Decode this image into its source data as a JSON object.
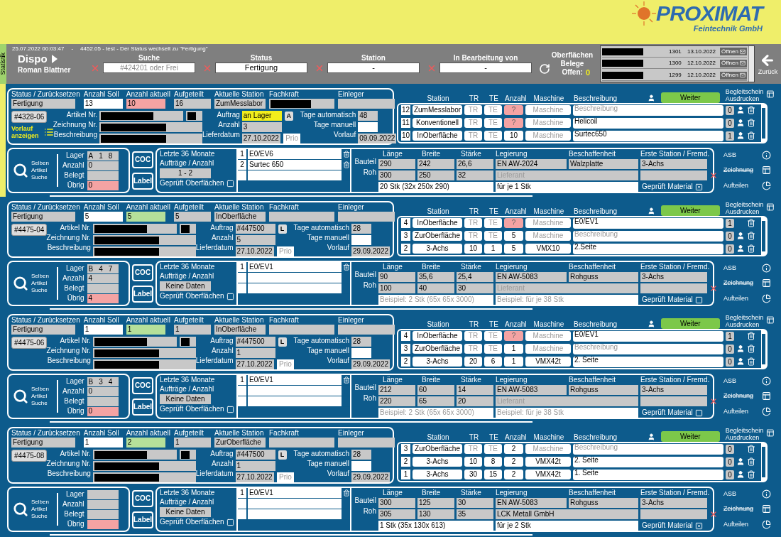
{
  "header": {
    "logo": {
      "name": "PROXIMAT",
      "tagline": "Feintechnik GmbH"
    }
  },
  "toolbar": {
    "side_tab": "Statistik",
    "timestamp": "25.07.2022 00:03:47",
    "separator": "-",
    "message": "4452.05 - test - Der Status wechselt zu \"Fertigung\"",
    "title": "Dispo",
    "user": "Roman Blattner",
    "filters": [
      {
        "label": "Suche",
        "placeholder": "#424201 oder Frei"
      },
      {
        "label": "Status",
        "value": "Fertigung"
      },
      {
        "label": "Station",
        "value": "-"
      },
      {
        "label": "In Bearbeitung von",
        "value": "-"
      }
    ],
    "open_title": "Oberflächen Belege",
    "open_label": "Offen:",
    "open_count": "0",
    "documents": [
      {
        "redacted": true,
        "number": "1301",
        "date": "13.10.2022",
        "action": "Öffnen"
      },
      {
        "redacted": true,
        "number": "1300",
        "date": "12.10.2022",
        "action": "Öffnen"
      },
      {
        "redacted": true,
        "number": "1299",
        "date": "12.10.2022",
        "action": "Öffnen"
      }
    ],
    "back": "Zurück"
  },
  "records": [
    {
      "selected": true,
      "id": "#4328-06",
      "vorlauf_link": "Vorlauf anzeigen",
      "labels": {
        "status": "Status / Zurücksetzen",
        "soll": "Anzahl Soll",
        "aktuell": "Anzahl aktuell",
        "aufgeteilt": "Aufgeteilt",
        "station": "Aktuelle Station",
        "fachkraft": "Fachkraft",
        "einleger": "Einleger",
        "artikel": "Artikel Nr.",
        "zeichnung": "Zeichnung Nr.",
        "beschreibung": "Beschreibung",
        "auftrag": "Auftrag",
        "anzahl": "Anzahl",
        "lieferdatum": "Lieferdatum",
        "prio": "Prio",
        "tage_auto": "Tage automatisch",
        "tage_manuell": "Tage manuell",
        "vorlauf": "Vorlauf",
        "search": "Selben Artikel Suche",
        "lager": "Lager",
        "lager_anzahl": "Anzahl",
        "belegt": "Belegt",
        "uebrig": "Übrig",
        "coc": "COC",
        "label": "Label",
        "letzte": "Letzte 36 Monate",
        "auftraege": "Aufträge / Anzahl",
        "geprueft_of": "Geprüft Oberflächen",
        "bauteil": "Bauteil",
        "roh": "Roh",
        "dims": [
          "Länge",
          "Breite",
          "Stärke",
          "Legierung",
          "Beschaffenheit",
          "Erste Station / Fremd."
        ],
        "geprueft_mat": "Geprüft Material",
        "step_cols": [
          "Station",
          "TR",
          "TE",
          "Anzahl",
          "Maschine",
          "Beschreibung"
        ],
        "weiter": "Weiter",
        "begleitschein": "Begleitschein Ausdrucken",
        "asb": "ASB",
        "zeichnung_link": "Zeichnung",
        "aufteilen": "Aufteilen"
      },
      "status": "Fertigung",
      "soll": "13",
      "aktuell": {
        "value": "10",
        "matches": false
      },
      "aufgeteilt": "16",
      "station": "ZumMesslabor",
      "fachkraft": {
        "redacted": true
      },
      "artikel": {
        "redacted": true
      },
      "artikel_code": {
        "redacted": true
      },
      "zeichnung": {
        "redacted": true
      },
      "beschreibung": {
        "redacted": true
      },
      "auftrag": {
        "value": "an Lager",
        "highlighted": true
      },
      "auftrag_button": "A",
      "anzahl": "3",
      "lieferdatum": "27.10.2022",
      "tage_auto": "48",
      "vorlauf": "09.09.2022",
      "lager": [
        "A",
        "1",
        "8"
      ],
      "lager_anzahl": "0",
      "uebrig": "0",
      "stats": "1 - 2",
      "geprueft_of": false,
      "surfaces": [
        {
          "no": "1",
          "name": "E0/EV6"
        },
        {
          "no": "2",
          "name": "Surtec 650"
        }
      ],
      "bauteil": [
        "290",
        "242",
        "26,6"
      ],
      "roh": [
        "300",
        "250",
        "32"
      ],
      "legierung": "EN AW-2024",
      "beschaffenheit": "Walzplatte",
      "erste_station": "3-Achs",
      "lieferant": {
        "placeholder": "Lieferant"
      },
      "stueck": {
        "value": "20 Stk (32x 250x 290)"
      },
      "je": {
        "value": "für je 1 Stk"
      },
      "geprueft_mat": true,
      "steps": [
        {
          "no": "12",
          "station": "ZumMesslabor",
          "tr": {
            "placeholder": "TR"
          },
          "te": {
            "placeholder": "TE"
          },
          "anzahl": {
            "placeholder": "?",
            "warn": true
          },
          "maschine": {
            "placeholder": "Maschine"
          },
          "beschreibung": {
            "placeholder": "Beschreibung"
          },
          "count": "0",
          "person": true
        },
        {
          "no": "11",
          "station": "Konventionell",
          "tr": {
            "placeholder": "TR"
          },
          "te": {
            "placeholder": "TE"
          },
          "anzahl": {
            "placeholder": "?",
            "warn": true
          },
          "maschine": {
            "placeholder": "Maschine"
          },
          "beschreibung": {
            "value": "Helicoil"
          },
          "count": "0",
          "person": true
        },
        {
          "no": "10",
          "station": "InOberfläche",
          "tr": {
            "placeholder": "TR"
          },
          "te": {
            "placeholder": "TE"
          },
          "anzahl": {
            "value": "10",
            "warn": false
          },
          "maschine": {
            "placeholder": "Maschine"
          },
          "beschreibung": {
            "value": "Surtec650"
          },
          "count": "1",
          "person": true
        }
      ]
    },
    {
      "selected": false,
      "id": "#4475-04",
      "labels": {
        "status": "Status / Zurücksetzen",
        "soll": "Anzahl Soll",
        "aktuell": "Anzahl aktuell",
        "aufgeteilt": "Aufgeteilt",
        "station": "Aktuelle Station",
        "fachkraft": "Fachkraft",
        "einleger": "Einleger",
        "artikel": "Artikel Nr.",
        "zeichnung": "Zeichnung Nr.",
        "beschreibung": "Beschreibung",
        "auftrag": "Auftrag",
        "anzahl": "Anzahl",
        "lieferdatum": "Lieferdatum",
        "prio": "Prio",
        "tage_auto": "Tage automatisch",
        "tage_manuell": "Tage manuell",
        "vorlauf": "Vorlauf",
        "search": "Selben Artikel Suche",
        "lager": "Lager",
        "lager_anzahl": "Anzahl",
        "belegt": "Belegt",
        "uebrig": "Übrig",
        "coc": "COC",
        "label": "Label",
        "letzte": "Letzte 36 Monate",
        "auftraege": "Aufträge / Anzahl",
        "geprueft_of": "Geprüft Oberflächen",
        "bauteil": "Bauteil",
        "roh": "Roh",
        "dims": [
          "Länge",
          "Breite",
          "Stärke",
          "Legierung",
          "Beschaffenheit",
          "Erste Station / Fremd."
        ],
        "geprueft_mat": "Geprüft Material",
        "step_cols": [
          "Station",
          "TR",
          "TE",
          "Anzahl",
          "Maschine",
          "Beschreibung"
        ],
        "weiter": "Weiter",
        "begleitschein": "Begleitschein Ausdrucken",
        "asb": "ASB",
        "zeichnung_link": "Zeichnung",
        "aufteilen": "Aufteilen"
      },
      "status": "Fertigung",
      "soll": "5",
      "aktuell": {
        "value": "5",
        "matches": true
      },
      "aufgeteilt": "5",
      "station": "InOberfläche",
      "artikel": {
        "redacted": true
      },
      "artikel_code": {
        "redacted": true
      },
      "zeichnung": {
        "redacted": true
      },
      "beschreibung": {
        "redacted": true
      },
      "auftrag": {
        "value": "#447500",
        "highlighted": false
      },
      "auftrag_button": "L",
      "anzahl": "5",
      "lieferdatum": "27.10.2022",
      "tage_auto": "28",
      "vorlauf": "29.09.2022",
      "lager": [
        "B",
        "4",
        "7"
      ],
      "lager_anzahl": "4",
      "uebrig": "4",
      "stats": "Keine Daten",
      "geprueft_of": false,
      "surfaces": [
        {
          "no": "1",
          "name": "E0/EV1"
        }
      ],
      "bauteil": [
        "90",
        "35,6",
        "25,4"
      ],
      "roh": [
        "100",
        "40",
        "30"
      ],
      "legierung": "EN AW-5083",
      "beschaffenheit": "Rohguss",
      "erste_station": "3-Achs",
      "lieferant": {
        "placeholder": "Lieferant"
      },
      "stueck": {
        "placeholder": "Beispiel: 2 Stk (65x 65x 3000)"
      },
      "je": {
        "placeholder": "Beispiel: für je 38 Stk"
      },
      "geprueft_mat": false,
      "steps": [
        {
          "no": "4",
          "station": "InOberfläche",
          "tr": {
            "placeholder": "TR"
          },
          "te": {
            "placeholder": "TE"
          },
          "anzahl": {
            "placeholder": "?",
            "warn": true
          },
          "maschine": {
            "placeholder": "Maschine"
          },
          "beschreibung": {
            "value": "E0/EV1"
          },
          "count": "1",
          "person": false
        },
        {
          "no": "3",
          "station": "ZurOberfläche",
          "tr": {
            "placeholder": "TR"
          },
          "te": {
            "placeholder": "TE"
          },
          "anzahl": {
            "value": "5",
            "warn": false
          },
          "maschine": {
            "placeholder": "Maschine"
          },
          "beschreibung": {
            "placeholder": "Beschreibung"
          },
          "count": "0",
          "person": true
        },
        {
          "no": "2",
          "station": "3-Achs",
          "tr": {
            "value": "10"
          },
          "te": {
            "value": "1"
          },
          "anzahl": {
            "value": "5",
            "warn": false
          },
          "maschine": {
            "value": "VMX10"
          },
          "beschreibung": {
            "value": "2.Seite"
          },
          "count": "0",
          "person": true
        }
      ]
    },
    {
      "selected": false,
      "id": "#4475-06",
      "labels": {
        "status": "Status / Zurücksetzen",
        "soll": "Anzahl Soll",
        "aktuell": "Anzahl aktuell",
        "aufgeteilt": "Aufgeteilt",
        "station": "Aktuelle Station",
        "fachkraft": "Fachkraft",
        "einleger": "Einleger",
        "artikel": "Artikel Nr.",
        "zeichnung": "Zeichnung Nr.",
        "beschreibung": "Beschreibung",
        "auftrag": "Auftrag",
        "anzahl": "Anzahl",
        "lieferdatum": "Lieferdatum",
        "prio": "Prio",
        "tage_auto": "Tage automatisch",
        "tage_manuell": "Tage manuell",
        "vorlauf": "Vorlauf",
        "search": "Selben Artikel Suche",
        "lager": "Lager",
        "lager_anzahl": "Anzahl",
        "belegt": "Belegt",
        "uebrig": "Übrig",
        "coc": "COC",
        "label": "Label",
        "letzte": "Letzte 36 Monate",
        "auftraege": "Aufträge / Anzahl",
        "geprueft_of": "Geprüft Oberflächen",
        "bauteil": "Bauteil",
        "roh": "Roh",
        "dims": [
          "Länge",
          "Breite",
          "Stärke",
          "Legierung",
          "Beschaffenheit",
          "Erste Station / Fremd."
        ],
        "geprueft_mat": "Geprüft Material",
        "step_cols": [
          "Station",
          "TR",
          "TE",
          "Anzahl",
          "Maschine",
          "Beschreibung"
        ],
        "weiter": "Weiter",
        "begleitschein": "Begleitschein Ausdrucken",
        "asb": "ASB",
        "zeichnung_link": "Zeichnung",
        "aufteilen": "Aufteilen"
      },
      "status": "Fertigung",
      "soll": "1",
      "aktuell": {
        "value": "1",
        "matches": true
      },
      "aufgeteilt": "1",
      "station": "InOberfläche",
      "artikel": {
        "redacted": true
      },
      "artikel_code": {
        "redacted": true
      },
      "zeichnung": {
        "redacted": true
      },
      "beschreibung": {
        "redacted": true
      },
      "auftrag": {
        "value": "#447500",
        "highlighted": false
      },
      "auftrag_button": "L",
      "anzahl": "1",
      "lieferdatum": "27.10.2022",
      "tage_auto": "28",
      "vorlauf": "29.09.2022",
      "lager": [
        "B",
        "3",
        "4"
      ],
      "lager_anzahl": "0",
      "uebrig": "0",
      "stats": "Keine Daten",
      "geprueft_of": false,
      "surfaces": [
        {
          "no": "1",
          "name": "E0/EV1"
        }
      ],
      "bauteil": [
        "212",
        "60",
        "14"
      ],
      "roh": [
        "220",
        "65",
        "20"
      ],
      "legierung": "EN AW-5083",
      "beschaffenheit": "Rohguss",
      "erste_station": "3-Achs",
      "lieferant": {
        "placeholder": "Lieferant"
      },
      "stueck": {
        "placeholder": "Beispiel: 2 Stk (65x 65x 3000)"
      },
      "je": {
        "placeholder": "Beispiel: für je 38 Stk"
      },
      "geprueft_mat": false,
      "steps": [
        {
          "no": "4",
          "station": "InOberfläche",
          "tr": {
            "placeholder": "TR"
          },
          "te": {
            "placeholder": "TE"
          },
          "anzahl": {
            "placeholder": "?",
            "warn": true
          },
          "maschine": {
            "placeholder": "Maschine"
          },
          "beschreibung": {
            "value": "E0/EV1"
          },
          "count": "1",
          "person": false
        },
        {
          "no": "3",
          "station": "ZurOberfläche",
          "tr": {
            "placeholder": "TR"
          },
          "te": {
            "placeholder": "TE"
          },
          "anzahl": {
            "value": "1",
            "warn": false
          },
          "maschine": {
            "placeholder": "Maschine"
          },
          "beschreibung": {
            "placeholder": "Beschreibung"
          },
          "count": "0",
          "person": true
        },
        {
          "no": "2",
          "station": "3-Achs",
          "tr": {
            "value": "20"
          },
          "te": {
            "value": "6"
          },
          "anzahl": {
            "value": "1",
            "warn": false
          },
          "maschine": {
            "value": "VMX42t"
          },
          "beschreibung": {
            "value": "2. Seite"
          },
          "count": "0",
          "person": true
        }
      ]
    },
    {
      "selected": false,
      "id": "#4475-08",
      "labels": {
        "status": "Status / Zurücksetzen",
        "soll": "Anzahl Soll",
        "aktuell": "Anzahl aktuell",
        "aufgeteilt": "Aufgeteilt",
        "station": "Aktuelle Station",
        "fachkraft": "Fachkraft",
        "einleger": "Einleger",
        "artikel": "Artikel Nr.",
        "zeichnung": "Zeichnung Nr.",
        "beschreibung": "Beschreibung",
        "auftrag": "Auftrag",
        "anzahl": "Anzahl",
        "lieferdatum": "Lieferdatum",
        "prio": "Prio",
        "tage_auto": "Tage automatisch",
        "tage_manuell": "Tage manuell",
        "vorlauf": "Vorlauf",
        "search": "Selben Artikel Suche",
        "lager": "Lager",
        "lager_anzahl": "Anzahl",
        "belegt": "Belegt",
        "uebrig": "Übrig",
        "coc": "COC",
        "label": "Label",
        "letzte": "Letzte 36 Monate",
        "auftraege": "Aufträge / Anzahl",
        "geprueft_of": "Geprüft Oberflächen",
        "bauteil": "Bauteil",
        "roh": "Roh",
        "dims": [
          "Länge",
          "Breite",
          "Stärke",
          "Legierung",
          "Beschaffenheit",
          "Erste Station / Fremd."
        ],
        "geprueft_mat": "Geprüft Material",
        "step_cols": [
          "Station",
          "TR",
          "TE",
          "Anzahl",
          "Maschine",
          "Beschreibung"
        ],
        "weiter": "Weiter",
        "begleitschein": "Begleitschein Ausdrucken",
        "asb": "ASB",
        "zeichnung_link": "Zeichnung",
        "aufteilen": "Aufteilen"
      },
      "status": "Fertigung",
      "soll": "1",
      "aktuell": {
        "value": "2",
        "matches": true
      },
      "aufgeteilt": "1",
      "station": "ZurOberfläche",
      "artikel": {
        "redacted": true
      },
      "artikel_code": {
        "redacted": true
      },
      "zeichnung": {
        "redacted": true
      },
      "beschreibung": {
        "redacted": true
      },
      "auftrag": {
        "value": "#447500",
        "highlighted": false
      },
      "auftrag_button": "L",
      "anzahl": "1",
      "lieferdatum": "27.10.2022",
      "tage_auto": "28",
      "vorlauf": "29.09.2022",
      "stats": "Keine Daten",
      "geprueft_of": false,
      "surfaces": [
        {
          "no": "1",
          "name": "E0/EV1"
        }
      ],
      "bauteil": [
        "300",
        "125",
        "30"
      ],
      "roh": [
        "305",
        "130",
        "35"
      ],
      "legierung": "EN AW-5083",
      "beschaffenheit": "Rohguss",
      "erste_station": "3-Achs",
      "lieferant": {
        "value": "LCK Metall GmbH"
      },
      "stueck": {
        "value": "1 Stk (35x 130x 613)"
      },
      "je": {
        "value": "für je 2 Stk"
      },
      "geprueft_mat": true,
      "steps": [
        {
          "no": "3",
          "station": "ZurOberfläche",
          "tr": {
            "placeholder": "TR"
          },
          "te": {
            "placeholder": "TE"
          },
          "anzahl": {
            "value": "2",
            "warn": false
          },
          "maschine": {
            "placeholder": "Maschine"
          },
          "beschreibung": {
            "placeholder": "Beschreibung"
          },
          "count": "0",
          "person": false
        },
        {
          "no": "2",
          "station": "3-Achs",
          "tr": {
            "value": "10"
          },
          "te": {
            "value": "8"
          },
          "anzahl": {
            "value": "2",
            "warn": false
          },
          "maschine": {
            "value": "VMX42t"
          },
          "beschreibung": {
            "value": "2. Seite"
          },
          "count": "0",
          "person": true
        },
        {
          "no": "1",
          "station": "3-Achs",
          "tr": {
            "value": "30"
          },
          "te": {
            "value": "15"
          },
          "anzahl": {
            "value": "2",
            "warn": false
          },
          "maschine": {
            "value": "VMX42t"
          },
          "beschreibung": {
            "value": "1. Seite"
          },
          "count": "0",
          "person": true
        }
      ]
    }
  ]
}
